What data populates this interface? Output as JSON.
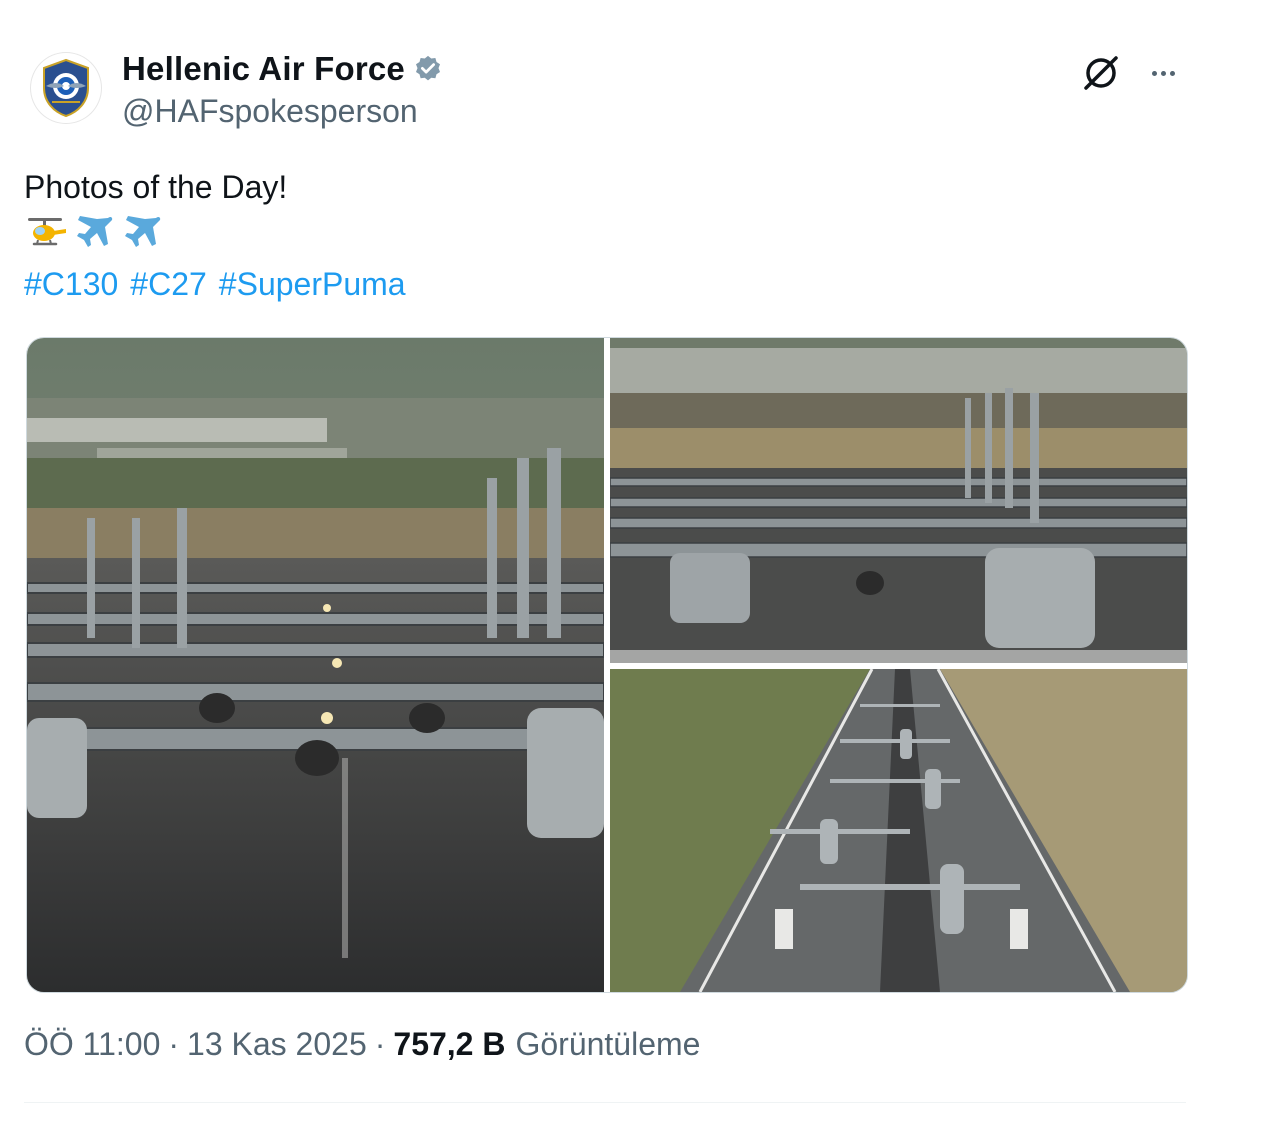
{
  "account": {
    "display_name": "Hellenic Air Force",
    "handle": "@HAFspokesperson",
    "verified": true,
    "avatar_icon": "hellenic-air-force-emblem-icon"
  },
  "tweet": {
    "text": "Photos of the Day!",
    "emojis": [
      "helicopter",
      "airplane",
      "airplane"
    ],
    "hashtags": [
      "#C130",
      "#C27",
      "#SuperPuma"
    ]
  },
  "media": {
    "photos": [
      {
        "name": "c130-elephant-walk-front"
      },
      {
        "name": "c130-elephant-walk-front-close"
      },
      {
        "name": "elephant-walk-aerial"
      }
    ]
  },
  "meta": {
    "time": "ÖÖ 11:00",
    "separator": "·",
    "date": "13 Kas 2025",
    "views": "757,2 B",
    "views_label": "Görüntüleme"
  },
  "colors": {
    "link": "#1d9bf0",
    "secondary_text": "#536471",
    "primary_text": "#0f1419",
    "verified": "#829aab"
  }
}
